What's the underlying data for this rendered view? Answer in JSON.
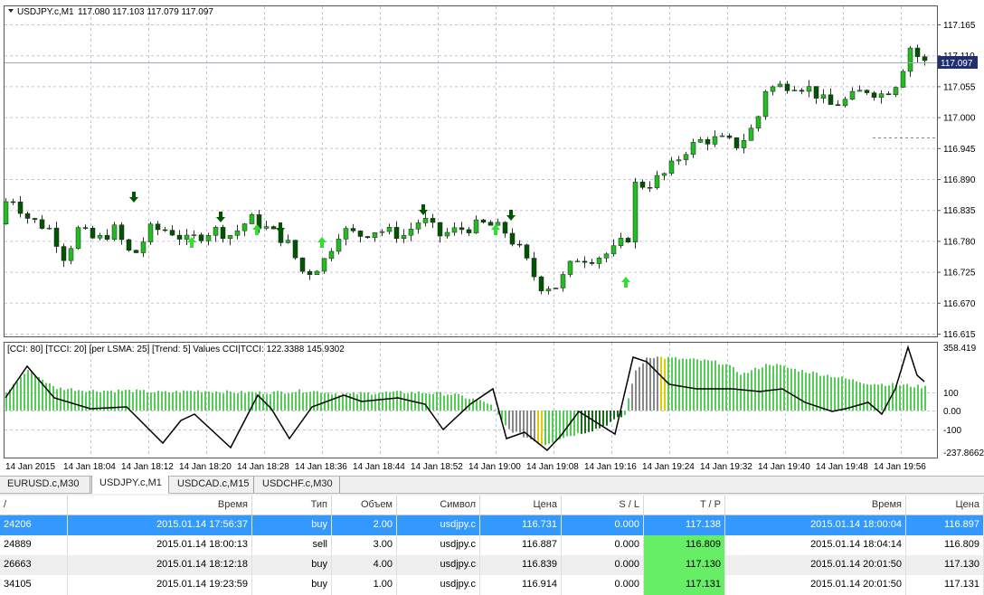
{
  "chart": {
    "title": "USDJPY.c,M1",
    "ohlc": "117.080 117.103 117.079 117.097",
    "current_price": "117.097",
    "price_axis": [
      "117.165",
      "117.110",
      "117.055",
      "117.000",
      "116.945",
      "116.890",
      "116.835",
      "116.780",
      "116.725",
      "116.670",
      "116.615"
    ],
    "indicator_label": "[CCI: 80] [TCCI: 20] [per LSMA: 25] [Trend: 5] Values CCI|TCCI: 122.3388 145.9302",
    "indicator_axis": [
      "358.419",
      "100",
      "0.00",
      "-100",
      "-237.8662"
    ],
    "time_axis": [
      "14 Jan 2015",
      "14 Jan 18:04",
      "14 Jan 18:12",
      "14 Jan 18:20",
      "14 Jan 18:28",
      "14 Jan 18:36",
      "14 Jan 18:44",
      "14 Jan 18:52",
      "14 Jan 19:00",
      "14 Jan 19:08",
      "14 Jan 19:16",
      "14 Jan 19:24",
      "14 Jan 19:32",
      "14 Jan 19:40",
      "14 Jan 19:48",
      "14 Jan 19:56"
    ],
    "colors": {
      "bull": "#22bb22",
      "bear": "#005500",
      "grid": "#c0c8d8",
      "accent": "#1f2f6f"
    }
  },
  "tabs": [
    {
      "label": "EURUSD.c,M30",
      "active": false
    },
    {
      "label": "USDJPY.c,M1",
      "active": true
    },
    {
      "label": "USDCAD.c,M15",
      "active": false
    },
    {
      "label": "USDCHF.c,M30",
      "active": false
    }
  ],
  "table": {
    "headers": [
      "/",
      "Время",
      "Тип",
      "Объем",
      "Символ",
      "Цена",
      "S / L",
      "T / P",
      "Время",
      "Цена"
    ],
    "rows": [
      [
        "24206",
        "2015.01.14 17:56:37",
        "buy",
        "2.00",
        "usdjpy.c",
        "116.731",
        "0.000",
        "117.138",
        "2015.01.14 18:00:04",
        "116.897"
      ],
      [
        "24889",
        "2015.01.14 18:00:13",
        "sell",
        "3.00",
        "usdjpy.c",
        "116.887",
        "0.000",
        "116.809",
        "2015.01.14 18:04:14",
        "116.809"
      ],
      [
        "26663",
        "2015.01.14 18:12:18",
        "buy",
        "4.00",
        "usdjpy.c",
        "116.839",
        "0.000",
        "117.130",
        "2015.01.14 20:01:50",
        "117.130"
      ],
      [
        "34105",
        "2015.01.14 19:23:59",
        "buy",
        "1.00",
        "usdjpy.c",
        "116.914",
        "0.000",
        "117.131",
        "2015.01.14 20:01:50",
        "117.131"
      ]
    ]
  }
}
